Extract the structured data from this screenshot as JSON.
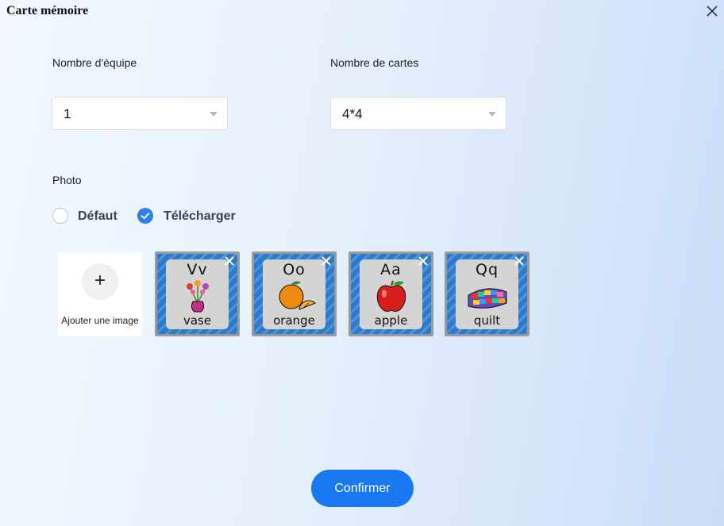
{
  "window": {
    "title": "Carte mémoire"
  },
  "teams": {
    "label": "Nombre d'équipe",
    "value": "1"
  },
  "cards": {
    "label": "Nombre de cartes",
    "value": "4*4"
  },
  "photo": {
    "label": "Photo",
    "options": [
      {
        "label": "Défaut",
        "selected": false
      },
      {
        "label": "Télécharger",
        "selected": true
      }
    ]
  },
  "upload": {
    "add_label": "Ajouter une image",
    "add_symbol": "+",
    "images": [
      {
        "letters": "Vv",
        "word": "vase",
        "icon": "vase-flowers-icon"
      },
      {
        "letters": "Oo",
        "word": "orange",
        "icon": "orange-icon"
      },
      {
        "letters": "Aa",
        "word": "apple",
        "icon": "apple-icon"
      },
      {
        "letters": "Qq",
        "word": "quilt",
        "icon": "quilt-icon"
      }
    ]
  },
  "confirm": {
    "label": "Confirmer"
  },
  "colors": {
    "accent": "#1778f2",
    "card_border": "#2f79c8"
  }
}
